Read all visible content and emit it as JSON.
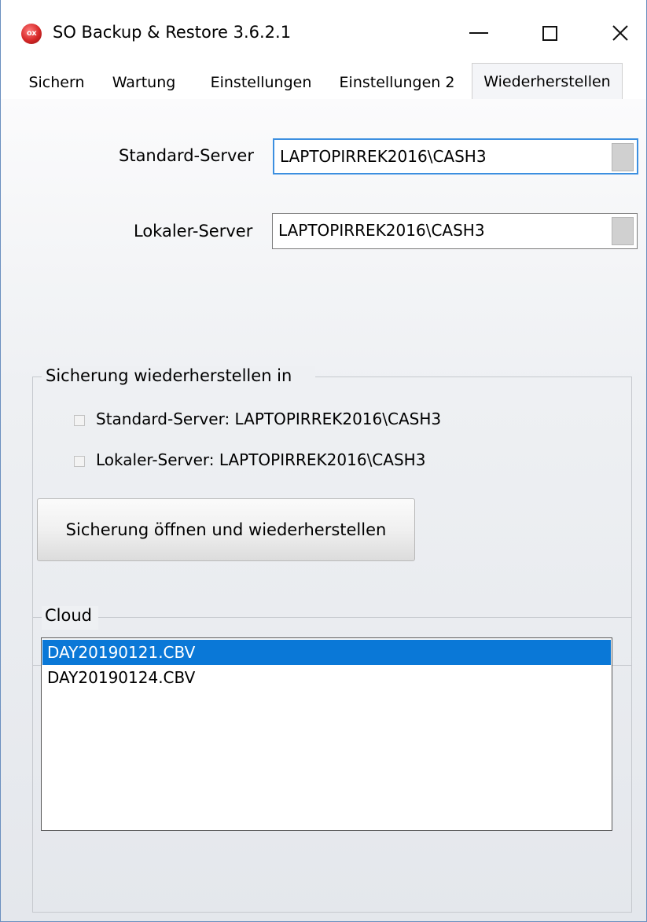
{
  "window": {
    "title": "SO Backup & Restore 3.6.2.1",
    "icon_text": "ox",
    "controls": [
      "minimize",
      "maximize",
      "close"
    ]
  },
  "tabs": [
    {
      "label": "Sichern",
      "active": false
    },
    {
      "label": "Wartung",
      "active": false
    },
    {
      "label": "Einstellungen",
      "active": false
    },
    {
      "label": "Einstellungen 2",
      "active": false
    },
    {
      "label": "Wiederherstellen",
      "active": true
    }
  ],
  "servers": {
    "standard": {
      "label": "Standard-Server",
      "value": "LAPTOPIRREK2016\\CASH3"
    },
    "local": {
      "label": "Lokaler-Server",
      "value": "LAPTOPIRREK2016\\CASH3"
    }
  },
  "restore_group": {
    "title": "Sicherung wiederherstellen in",
    "options": [
      {
        "label": "Standard-Server: LAPTOPIRREK2016\\CASH3",
        "checked": false
      },
      {
        "label": "Lokaler-Server: LAPTOPIRREK2016\\CASH3",
        "checked": false
      }
    ],
    "button_label": "Sicherung öffnen und wiederherstellen"
  },
  "cloud_group": {
    "title": "Cloud",
    "files": [
      {
        "name": "DAY20190121.CBV",
        "selected": true
      },
      {
        "name": "DAY20190124.CBV",
        "selected": false
      }
    ]
  },
  "colors": {
    "selection": "#0a78d7",
    "focus_border": "#3c8fe0"
  }
}
